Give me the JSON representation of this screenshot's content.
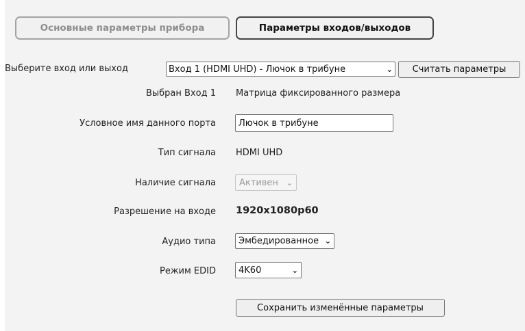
{
  "tabs": {
    "device_params": "Основные параметры прибора",
    "io_params": "Параметры входов/выходов"
  },
  "port_select": {
    "label": "Выберите вход или выход",
    "value": "Вход 1 (HDMI UHD) - Лючок в трибуне",
    "read_button": "Считать параметры"
  },
  "selected": {
    "label": "Выбран Вход 1",
    "value": "Матрица фиксированного размера"
  },
  "port_name": {
    "label": "Условное имя данного порта",
    "value": "Лючок в трибуне"
  },
  "signal_type": {
    "label": "Тип сигнала",
    "value": "HDMI UHD"
  },
  "signal_presence": {
    "label": "Наличие сигнала",
    "value": "Активен"
  },
  "resolution": {
    "label": "Разрешение на входе",
    "value": "1920x1080p60"
  },
  "audio": {
    "label": "Аудио типа",
    "value": "Эмбедированное"
  },
  "edid": {
    "label": "Режим EDID",
    "value": "4K60"
  },
  "save_button": "Сохранить изменённые параметры"
}
